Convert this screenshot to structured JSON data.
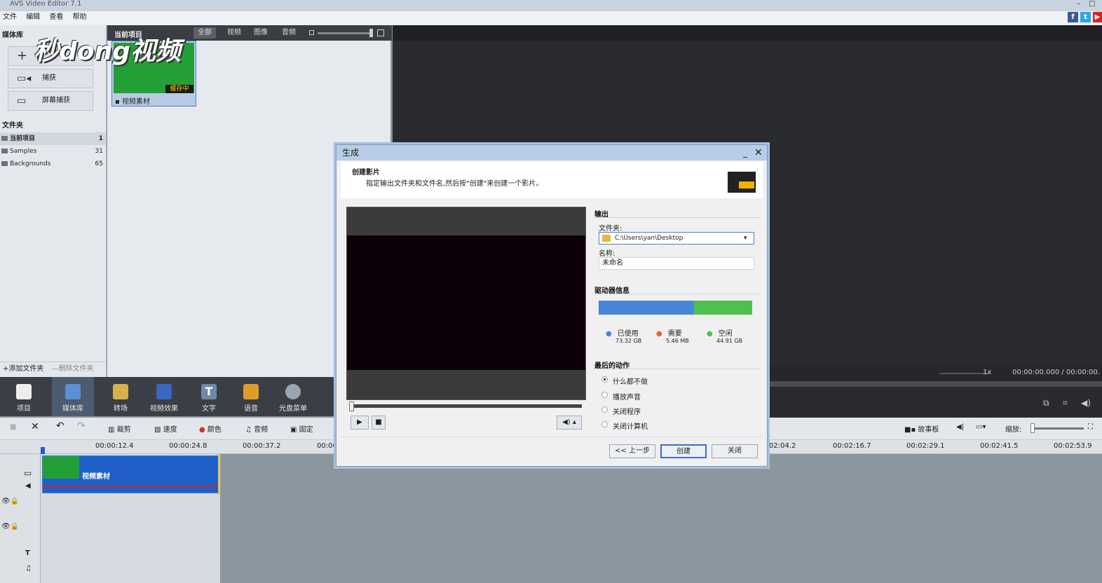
{
  "app": {
    "title": "AVS Video Editor 7.1",
    "menu": [
      "文件",
      "编辑",
      "查看",
      "帮助"
    ],
    "social": [
      "f",
      "t",
      "▶"
    ]
  },
  "left": {
    "header": "媒体库",
    "buttons": [
      {
        "label": "",
        "icon": "plus-icon"
      },
      {
        "label": "捕获",
        "icon": "camera-icon"
      },
      {
        "label": "屏幕捕获",
        "icon": "monitor-icon"
      }
    ],
    "folders_title": "文件夹",
    "folders": [
      {
        "name": "当前项目",
        "count": "1"
      },
      {
        "name": "Samples",
        "count": "31"
      },
      {
        "name": "Backgrounds",
        "count": "65"
      }
    ],
    "add_folder": "添加文件夹",
    "delete_folder": "删除文件夹"
  },
  "mid": {
    "header": "当前项目",
    "tabs": [
      "全部",
      "视频",
      "图像",
      "音频"
    ],
    "item_label": "视频素材",
    "item_badge": "缓存中"
  },
  "watermark": "秒dong视频",
  "preview": {
    "speed": "1x",
    "time": "00:00:00.000 / 00:00:00."
  },
  "tools": [
    "项目",
    "媒体库",
    "转场",
    "视频效果",
    "文字",
    "语音",
    "光盘菜单"
  ],
  "edit_tools": [
    "裁剪",
    "速度",
    "颜色",
    "音频",
    "固定"
  ],
  "right_tools": {
    "storyboard": "故事板",
    "zoom": "缩放:"
  },
  "ruler": [
    "00:00:12.4",
    "00:00:24.8",
    "00:00:37.2",
    "00:00",
    "02:04.2",
    "00:02:16.7",
    "00:02:29.1",
    "00:02:41.5",
    "00:02:53.9"
  ],
  "clip_label": "视频素材",
  "dialog": {
    "title": "生成",
    "heading": "创建影片",
    "subtitle": "指定输出文件夹和文件名,然后按\"创建\"来创建一个影片。",
    "output_label": "输出",
    "folder_label": "文件夹:",
    "folder_value": "C:\\Users\\yan\\Desktop",
    "name_label": "名称:",
    "name_value": "未命名",
    "drive_label": "驱动器信息",
    "drive_used_fraction": 0.62,
    "legend": [
      {
        "label": "已使用",
        "value": "73.32 GB",
        "color": "#4a86d8"
      },
      {
        "label": "需要",
        "value": "5.46 MB",
        "color": "#e8642a"
      },
      {
        "label": "空闲",
        "value": "44.91 GB",
        "color": "#4fc04f"
      }
    ],
    "final_action_label": "最后的动作",
    "final_actions": [
      "什么都不做",
      "播放声音",
      "关闭程序",
      "关闭计算机"
    ],
    "buttons": {
      "back": "<< 上一步",
      "create": "创建",
      "close": "关闭"
    }
  }
}
